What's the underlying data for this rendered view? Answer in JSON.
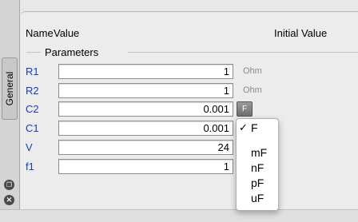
{
  "side_tab": {
    "label": "General"
  },
  "icons": {
    "detach": "detach-icon",
    "close": "close-icon"
  },
  "header": {
    "name": "Name",
    "value": "Value",
    "initial_value": "Initial Value"
  },
  "group": {
    "title": "Parameters"
  },
  "params": [
    {
      "name": "R1",
      "value": "1",
      "unit": "Ohm"
    },
    {
      "name": "R2",
      "value": "1",
      "unit": "Ohm"
    },
    {
      "name": "C2",
      "value": "0.001",
      "unit_button": "F"
    },
    {
      "name": "C1",
      "value": "0.001"
    },
    {
      "name": "V",
      "value": "24"
    },
    {
      "name": "f1",
      "value": "1"
    }
  ],
  "unit_menu": {
    "selected": "F",
    "check_mark": "✓",
    "options": [
      "F",
      "mF",
      "nF",
      "pF",
      "uF"
    ]
  }
}
